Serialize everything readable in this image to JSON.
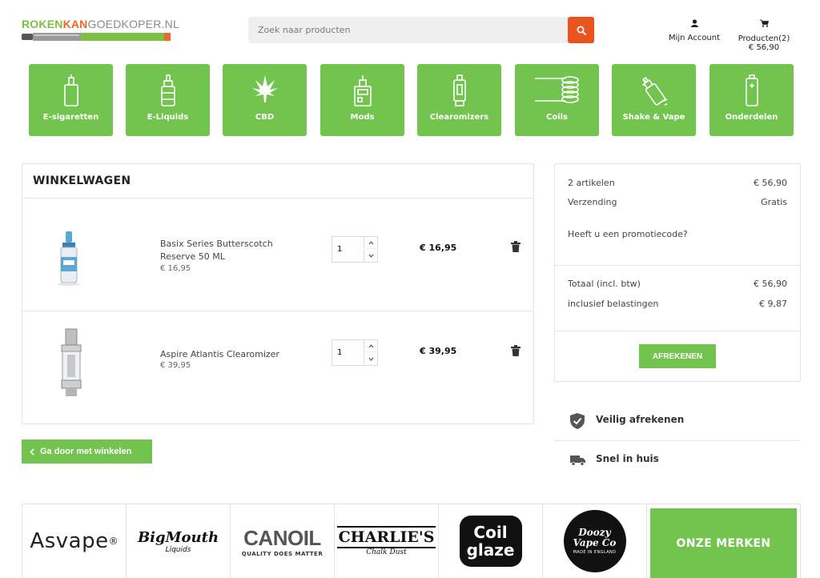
{
  "header": {
    "logo": {
      "part1": "ROKEN",
      "part2": "KAN",
      "part3": "GOEDKOPER.NL"
    },
    "search": {
      "placeholder": "Zoek naar producten",
      "icon": "search-icon"
    },
    "account_label": "Mijn Account",
    "cart_label": "Producten(2)",
    "cart_total": "€ 56,90"
  },
  "categories": [
    {
      "label": "E-sigaretten",
      "icon": "e-cigarette-icon"
    },
    {
      "label": "E-Liquids",
      "icon": "bottle-icon"
    },
    {
      "label": "CBD",
      "icon": "cannabis-leaf-icon"
    },
    {
      "label": "Mods",
      "icon": "mod-box-icon"
    },
    {
      "label": "Clearomizers",
      "icon": "clearomizer-icon"
    },
    {
      "label": "Coils",
      "icon": "coil-icon"
    },
    {
      "label": "Shake & Vape",
      "icon": "shake-bottle-icon"
    },
    {
      "label": "Onderdelen",
      "icon": "battery-icon"
    }
  ],
  "cart": {
    "title": "WINKELWAGEN",
    "items": [
      {
        "name": "Basix Series Butterscotch Reserve 50 ML",
        "unit_price": "€ 16,95",
        "qty": "1",
        "total": "€ 16,95"
      },
      {
        "name": "Aspire Atlantis Clearomizer",
        "unit_price": "€ 39,95",
        "qty": "1",
        "total": "€ 39,95"
      }
    ],
    "continue_label": "Ga door met winkelen"
  },
  "summary": {
    "articles_label": "2 artikelen",
    "articles_value": "€ 56,90",
    "shipping_label": "Verzending",
    "shipping_value": "Gratis",
    "promo_label": "Heeft u een promotiecode?",
    "total_label": "Totaal (incl. btw)",
    "total_value": "€ 56,90",
    "tax_label": "inclusief belastingen",
    "tax_value": "€ 9,87",
    "checkout_label": "AFREKENEN"
  },
  "assurances": [
    {
      "label": "Veilig afrekenen",
      "icon": "shield-check-icon"
    },
    {
      "label": "Snel in huis",
      "icon": "truck-icon"
    }
  ],
  "brands": {
    "items": [
      {
        "text": "Asvape",
        "mark": "®"
      },
      {
        "text": "BigMouth",
        "sub": "Liquids"
      },
      {
        "text": "CANOIL",
        "sub": "QUALITY DOES MATTER"
      },
      {
        "text": "CHARLIE'S",
        "sub": "Chalk Dust"
      },
      {
        "text": "Coil glaze"
      },
      {
        "text": "Doozy Vape Co",
        "sub": "MADE IN ENGLAND"
      }
    ],
    "cta": "ONZE MERKEN"
  },
  "colors": {
    "brand_green": "#72c44f",
    "accent_orange": "#e9531d"
  }
}
